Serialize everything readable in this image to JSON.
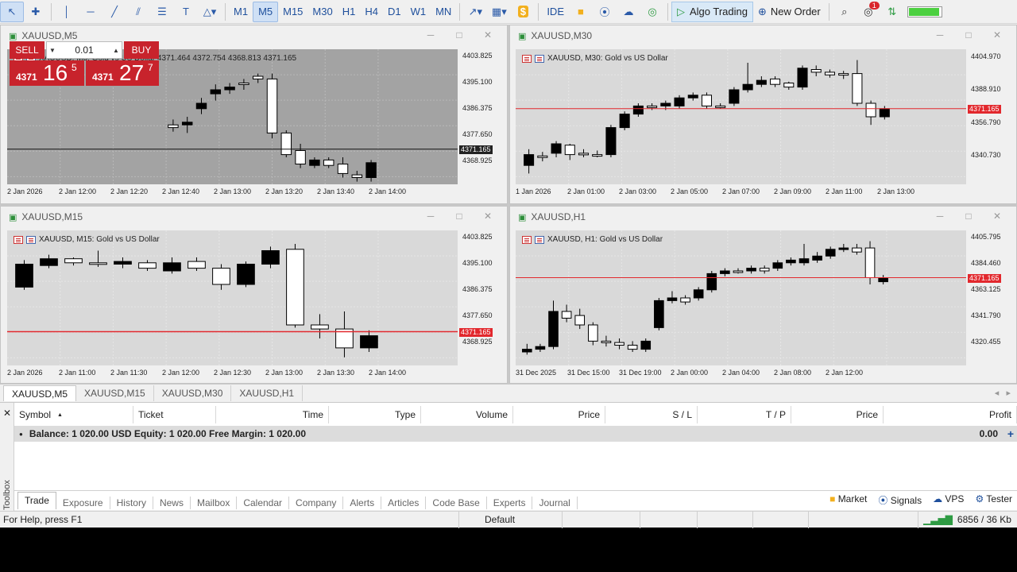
{
  "toolbar": {
    "timeframes": [
      "M1",
      "M5",
      "M15",
      "M30",
      "H1",
      "H4",
      "D1",
      "W1",
      "MN"
    ],
    "active_timeframe": "M5",
    "ide_label": "IDE",
    "algo_trading_label": "Algo Trading",
    "new_order_label": "New Order",
    "notification_count": "1"
  },
  "charts": [
    {
      "window_title": "XAUUSD,M5",
      "header": "XAUUSD, M5:  Gold vs US Dollar  4371.464 4372.754 4368.813 4371.165",
      "y_ticks": [
        "4403.825",
        "4395.100",
        "4386.375",
        "4377.650",
        "4368.925"
      ],
      "x_ticks": [
        "2 Jan 2026",
        "2 Jan 12:00",
        "2 Jan 12:20",
        "2 Jan 12:40",
        "2 Jan 13:00",
        "2 Jan 13:20",
        "2 Jan 13:40",
        "2 Jan 14:00"
      ],
      "price_tag": "4371.165"
    },
    {
      "window_title": "XAUUSD,M30",
      "header": "XAUUSD, M30:  Gold vs US Dollar",
      "y_ticks": [
        "4404.970",
        "4388.910",
        "4356.790",
        "4340.730"
      ],
      "x_ticks": [
        "1 Jan 2026",
        "2 Jan 01:00",
        "2 Jan 03:00",
        "2 Jan 05:00",
        "2 Jan 07:00",
        "2 Jan 09:00",
        "2 Jan 11:00",
        "2 Jan 13:00"
      ],
      "price_tag": "4371.165"
    },
    {
      "window_title": "XAUUSD,M15",
      "header": "XAUUSD, M15:  Gold vs US Dollar",
      "y_ticks": [
        "4403.825",
        "4395.100",
        "4386.375",
        "4377.650",
        "4368.925"
      ],
      "x_ticks": [
        "2 Jan 2026",
        "2 Jan 11:00",
        "2 Jan 11:30",
        "2 Jan 12:00",
        "2 Jan 12:30",
        "2 Jan 13:00",
        "2 Jan 13:30",
        "2 Jan 14:00"
      ],
      "price_tag": "4371.165"
    },
    {
      "window_title": "XAUUSD,H1",
      "header": "XAUUSD, H1:  Gold vs US Dollar",
      "y_ticks": [
        "4405.795",
        "4384.460",
        "4363.125",
        "4341.790",
        "4320.455"
      ],
      "x_ticks": [
        "31 Dec 2025",
        "31 Dec 15:00",
        "31 Dec 19:00",
        "2 Jan 00:00",
        "2 Jan 04:00",
        "2 Jan 08:00",
        "2 Jan 12:00"
      ],
      "price_tag": "4371.165"
    }
  ],
  "one_click": {
    "sell_label": "SELL",
    "buy_label": "BUY",
    "volume": "0.01",
    "sell_price_small": "4371",
    "sell_price_big": "16",
    "sell_price_sup": "5",
    "buy_price_small": "4371",
    "buy_price_big": "27",
    "buy_price_sup": "7"
  },
  "chart_tabs": [
    "XAUUSD,M5",
    "XAUUSD,M15",
    "XAUUSD,M30",
    "XAUUSD,H1"
  ],
  "toolbox": {
    "columns": [
      "Symbol",
      "Ticket",
      "Time",
      "Type",
      "Volume",
      "Price",
      "S / L",
      "T / P",
      "Price",
      "Profit"
    ],
    "balance_text": "Balance: 1 020.00 USD  Equity: 1 020.00  Free Margin: 1 020.00",
    "profit_total": "0.00",
    "side_label": "Toolbox",
    "tabs": [
      "Trade",
      "Exposure",
      "History",
      "News",
      "Mailbox",
      "Calendar",
      "Company",
      "Alerts",
      "Articles",
      "Code Base",
      "Experts",
      "Journal"
    ],
    "right_links": [
      "Market",
      "Signals",
      "VPS",
      "Tester"
    ]
  },
  "status": {
    "help": "For Help, press F1",
    "profile": "Default",
    "traffic": "6856 / 36 Kb"
  },
  "colors": {
    "price_line": "#e2282d",
    "sell": "#c8232c",
    "buy": "#c8232c",
    "algo_green": "#2e9b43"
  }
}
